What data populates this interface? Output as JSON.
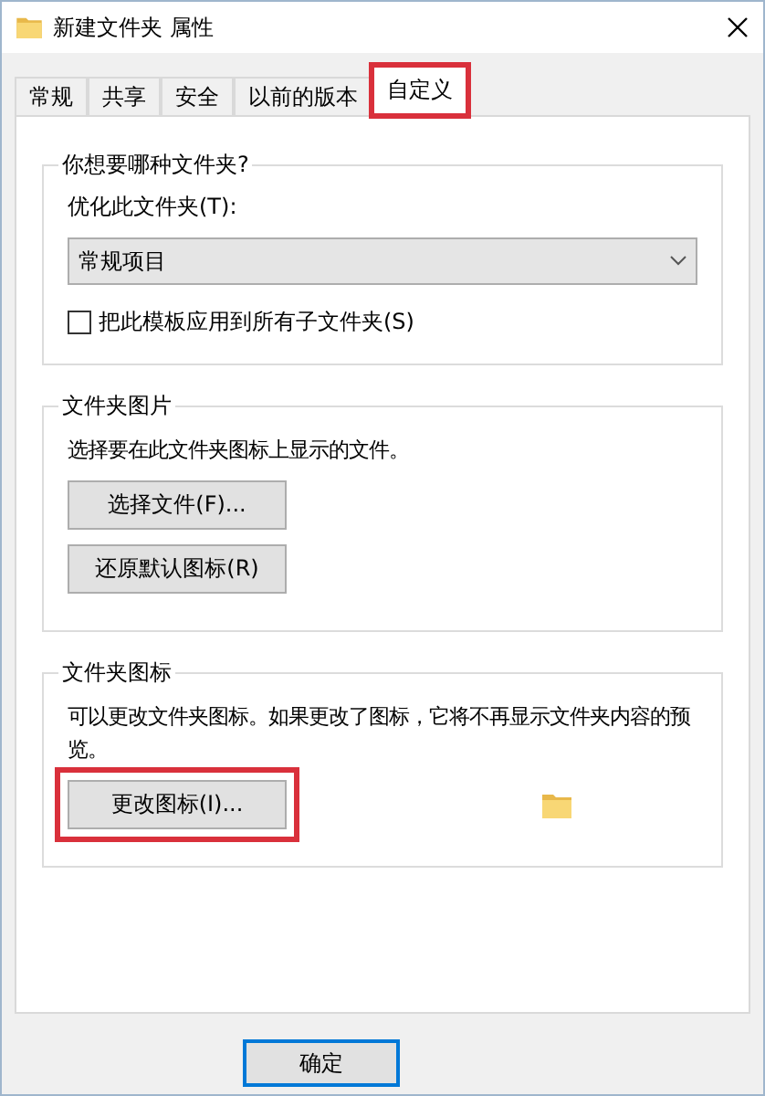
{
  "window": {
    "title": "新建文件夹 属性"
  },
  "tabs": [
    {
      "label": "常规",
      "selected": false,
      "highlighted": false
    },
    {
      "label": "共享",
      "selected": false,
      "highlighted": false
    },
    {
      "label": "安全",
      "selected": false,
      "highlighted": false
    },
    {
      "label": "以前的版本",
      "selected": false,
      "highlighted": false
    },
    {
      "label": "自定义",
      "selected": true,
      "highlighted": true
    }
  ],
  "groups": [
    {
      "legend": "你想要哪种文件夹?",
      "items": [
        {
          "kind": "label",
          "text": "优化此文件夹(T):"
        },
        {
          "kind": "dropdown",
          "value": "常规项目"
        },
        {
          "kind": "checkbox",
          "label": "把此模板应用到所有子文件夹(S)",
          "checked": false
        }
      ]
    },
    {
      "legend": "文件夹图片",
      "items": [
        {
          "kind": "text",
          "text": "选择要在此文件夹图标上显示的文件。"
        },
        {
          "kind": "button",
          "label": "选择文件(F)...",
          "highlighted": false,
          "folder_preview": false
        },
        {
          "kind": "button",
          "label": "还原默认图标(R)",
          "highlighted": false,
          "folder_preview": false
        }
      ]
    },
    {
      "legend": "文件夹图标",
      "items": [
        {
          "kind": "text",
          "text": "可以更改文件夹图标。如果更改了图标，它将不再显示文件夹内容的预览。"
        },
        {
          "kind": "button",
          "label": "更改图标(I)...",
          "highlighted": true,
          "folder_preview": true
        }
      ]
    }
  ],
  "footer": {
    "buttons": [
      {
        "label": "确定",
        "default": true
      }
    ]
  }
}
